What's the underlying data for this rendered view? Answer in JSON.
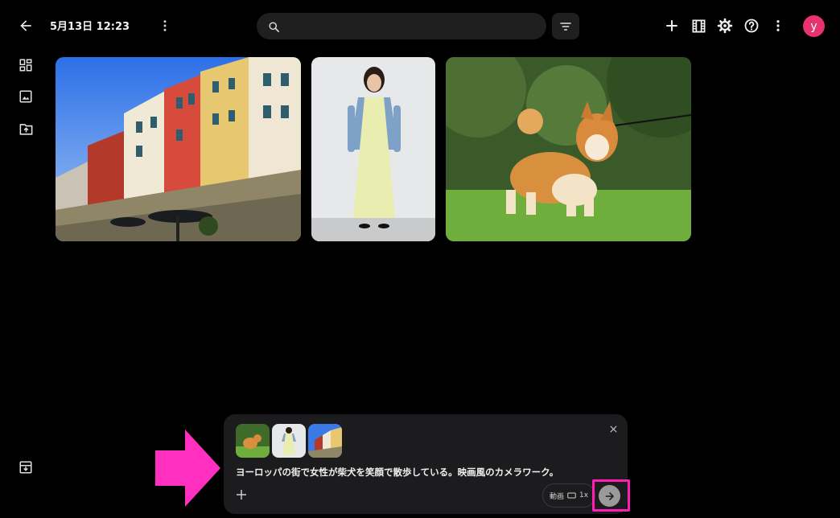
{
  "header": {
    "title": "5月13日 12:23",
    "search_placeholder": "",
    "avatar_initial": "y"
  },
  "colors": {
    "background": "#000000",
    "avatar": "#e8336e",
    "highlight": "#ff1fb4",
    "arrow": "#ff2fc0"
  },
  "composer": {
    "prompt": "ヨーロッパの街で女性が柴犬を笑顔で散歩している。映画風のカメラワーク。",
    "mode_label": "動画",
    "speed_label": "1x"
  },
  "icons": {
    "back": "arrow-left-icon",
    "more": "more-vert-icon",
    "search": "search-icon",
    "filter": "filter-icon",
    "add": "plus-icon",
    "film": "film-icon",
    "settings": "gear-icon",
    "help": "help-icon",
    "dashboard": "dashboard-icon",
    "image": "image-icon",
    "upload_folder": "folder-upload-icon",
    "archive": "archive-icon",
    "close": "close-icon",
    "send": "arrow-right-icon"
  }
}
